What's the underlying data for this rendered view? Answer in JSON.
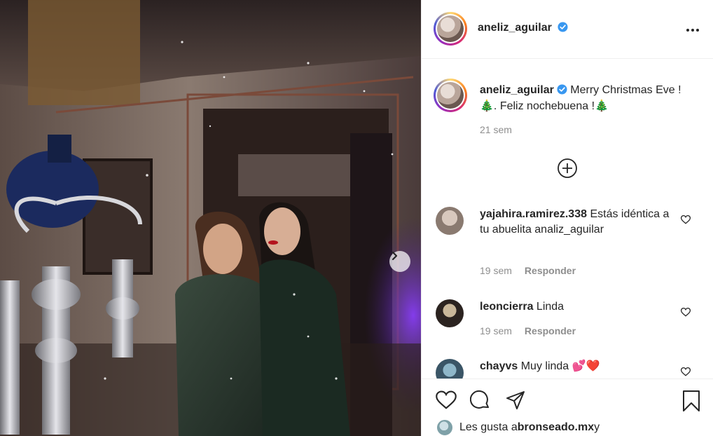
{
  "post": {
    "author": "aneliz_aguilar",
    "verified": true,
    "caption_line1": "Merry Christmas Eve !",
    "caption_line2": ". Feliz nochebuena !",
    "caption_emoji": "🎄",
    "caption_time": "21 sem"
  },
  "comments": [
    {
      "user": "yajahira.ramirez.338",
      "text": " Estás idéntica a tu abuelita analiz_aguilar",
      "time": "19 sem",
      "reply_label": "Responder"
    },
    {
      "user": "leoncierra",
      "text": " Linda",
      "time": "19 sem",
      "reply_label": "Responder"
    },
    {
      "user": "chayvs",
      "text": " Muy linda ",
      "emoji": "💕❤️"
    }
  ],
  "likes": {
    "prefix": "Les gusta a ",
    "user": "bronseado.mx",
    "suffix": " y"
  },
  "icons": {
    "verified": "verified-badge-icon",
    "more": "more-options-icon",
    "load_more": "plus-circle-icon",
    "like": "heart-icon",
    "comment": "comment-icon",
    "share": "share-icon",
    "save": "bookmark-icon",
    "carousel": "chevron-right-icon"
  },
  "colors": {
    "verified_blue": "#3897f0",
    "muted": "#8e8e8e",
    "text": "#262626"
  }
}
